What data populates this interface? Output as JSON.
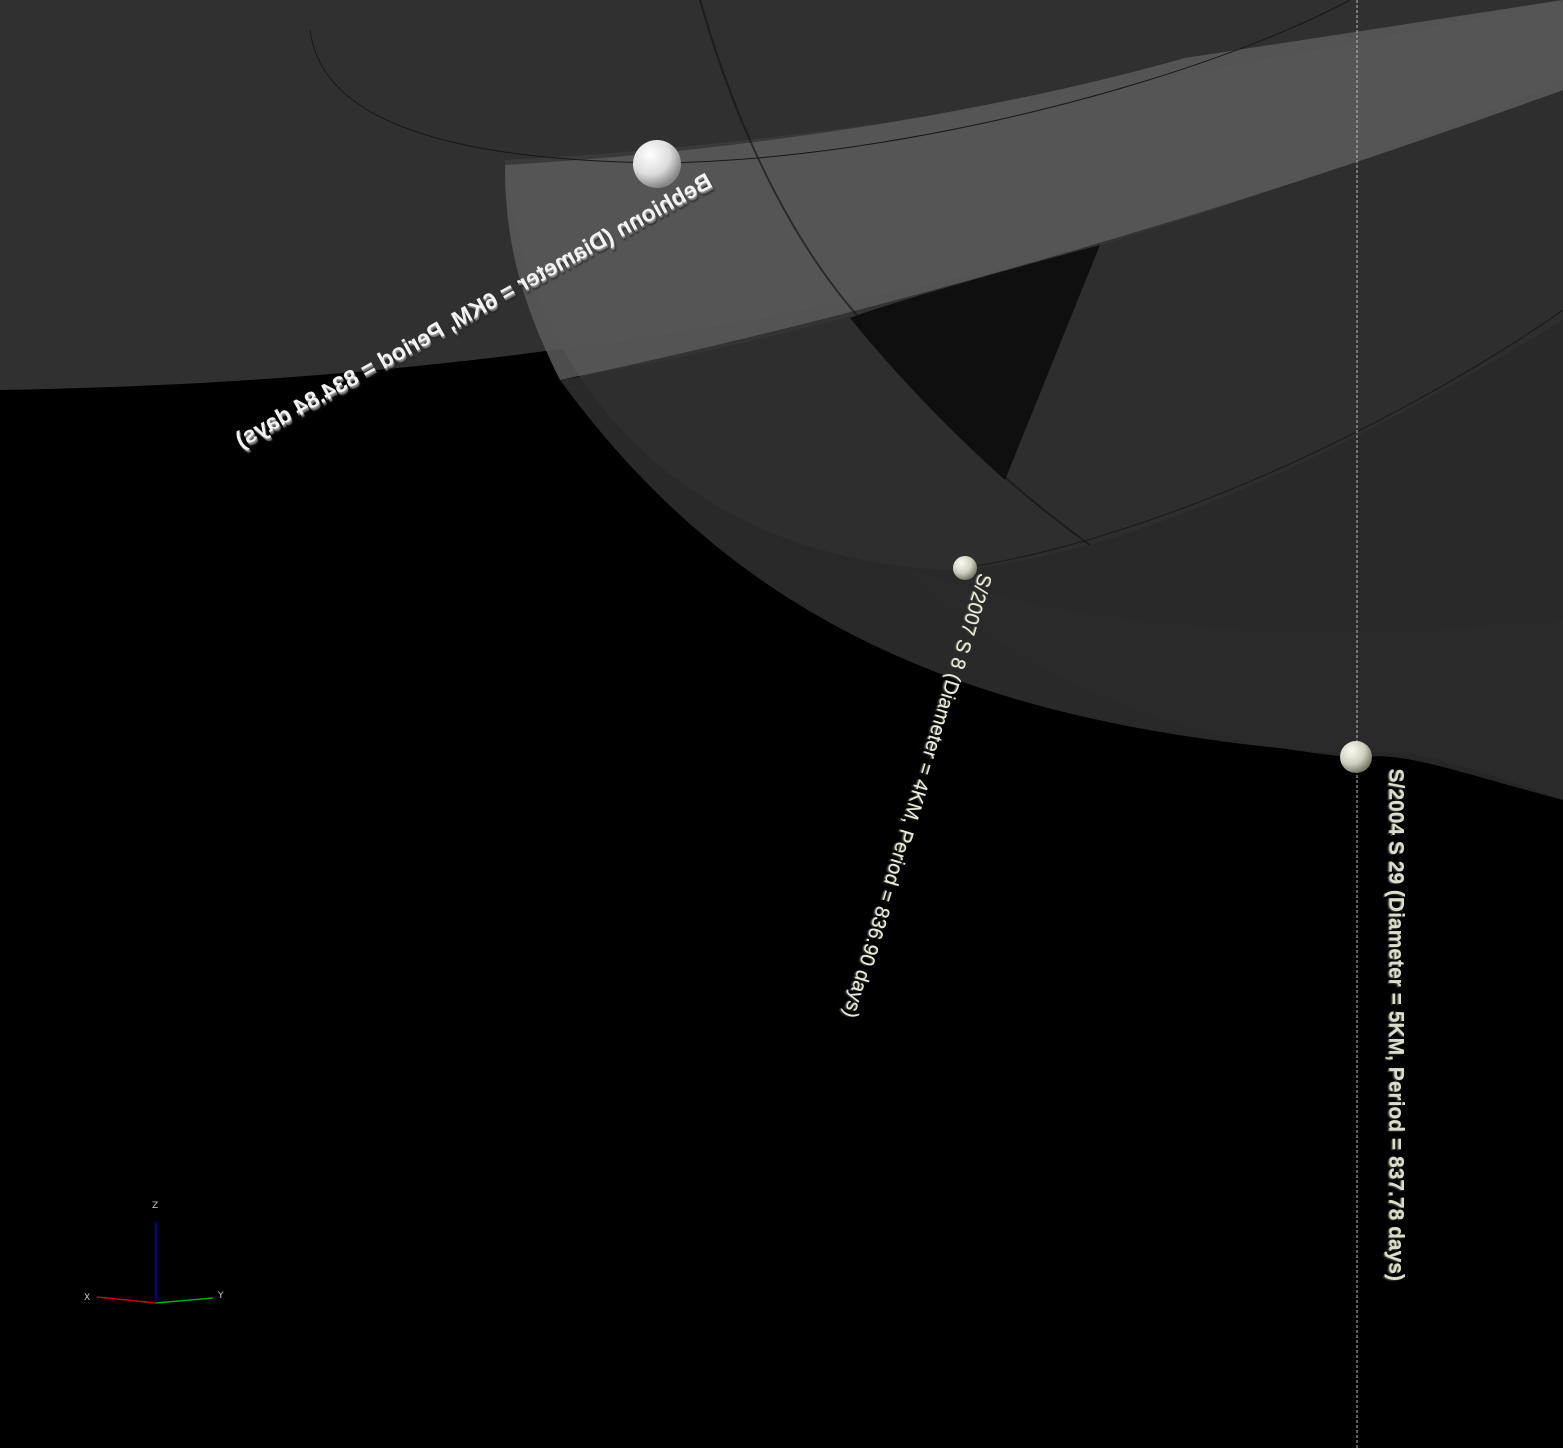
{
  "scene": {
    "background": "#000000",
    "orbit_shell_color": "#3a3a3a",
    "orbit_highlight_color": "#5a5a5a",
    "moons": [
      {
        "name_label": "Bebhionn (Diameter = 6KM, Period = 834.84 days)",
        "color": "#eeeeee"
      },
      {
        "name_label": "S/2007 S 8 (Diameter = 4KM, Period = 836.90 days)",
        "color": "#e0e0d0"
      },
      {
        "name_label": "S/2004 S 29 (Diameter = 5KM, Period = 837.78 days)",
        "color": "#e0e0d0"
      }
    ]
  },
  "axis_triad": {
    "z_label": "Z",
    "x_label": "X",
    "y_label": "Y",
    "x_color": "#cc0000",
    "y_color": "#00aa00",
    "z_color": "#0000cc"
  }
}
